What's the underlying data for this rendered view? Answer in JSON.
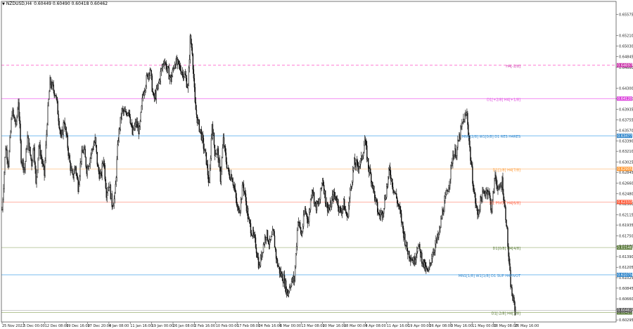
{
  "header": {
    "symbol": "NZDUSD,H4",
    "ohlc": "0.60449 0.60490 0.60418 0.60462"
  },
  "chart_data": {
    "type": "candlestick",
    "ylim": [
      0.6026,
      0.658
    ],
    "y_ticks": [
      "0.65575",
      "0.65210",
      "0.65030",
      "0.64845",
      "0.64660",
      "0.64300",
      "0.64120",
      "0.63935",
      "0.63755",
      "0.63570",
      "0.63390",
      "0.63210",
      "0.63025",
      "0.62845",
      "0.62660",
      "0.62480",
      "0.62300",
      "0.62115",
      "0.61935",
      "0.61750",
      "0.61570",
      "0.61390",
      "0.61205",
      "0.61025",
      "0.60845",
      "0.60660",
      "0.60480",
      "0.60295"
    ],
    "x_ticks": [
      "25 Nov 2022",
      "5 Dec 00:00",
      "12 Dec 08:00",
      "19 Dec 16:00",
      "27 Dec 20:00",
      "4 Jan 08:00",
      "11 Jan 16:00",
      "19 Jan 00:00",
      "26 Jan 08:00",
      "2 Feb 16:00",
      "10 Feb 00:00",
      "17 Feb 08:00",
      "24 Feb 16:00",
      "6 Mar 00:00",
      "13 Mar 08:00",
      "20 Mar 16:00",
      "28 Mar 00:00",
      "4 Apr 08:00",
      "11 Apr 16:00",
      "19 Apr 00:00",
      "26 Apr 08:00",
      "3 May 16:00",
      "11 May 00:00",
      "18 May 08:00",
      "25 May 16:00"
    ],
    "close_path": [
      [
        0,
        0.622
      ],
      [
        5,
        0.633
      ],
      [
        9,
        0.63
      ],
      [
        14,
        0.639
      ],
      [
        20,
        0.6365
      ],
      [
        23,
        0.641
      ],
      [
        27,
        0.631
      ],
      [
        32,
        0.629
      ],
      [
        36,
        0.6345
      ],
      [
        42,
        0.63
      ],
      [
        45,
        0.6335
      ],
      [
        48,
        0.6262
      ],
      [
        52,
        0.633
      ],
      [
        55,
        0.6315
      ],
      [
        60,
        0.628
      ],
      [
        64,
        0.6375
      ],
      [
        68,
        0.644
      ],
      [
        72,
        0.643
      ],
      [
        76,
        0.642
      ],
      [
        80,
        0.638
      ],
      [
        84,
        0.634
      ],
      [
        88,
        0.6375
      ],
      [
        92,
        0.634
      ],
      [
        96,
        0.63
      ],
      [
        100,
        0.6275
      ],
      [
        104,
        0.6295
      ],
      [
        108,
        0.626
      ],
      [
        112,
        0.631
      ],
      [
        116,
        0.6325
      ],
      [
        120,
        0.629
      ],
      [
        124,
        0.6305
      ],
      [
        128,
        0.6325
      ],
      [
        132,
        0.634
      ],
      [
        136,
        0.629
      ],
      [
        140,
        0.6275
      ],
      [
        144,
        0.631
      ],
      [
        148,
        0.625
      ],
      [
        152,
        0.6265
      ],
      [
        156,
        0.623
      ],
      [
        160,
        0.624
      ],
      [
        165,
        0.6345
      ],
      [
        170,
        0.639
      ],
      [
        175,
        0.6385
      ],
      [
        180,
        0.6395
      ],
      [
        185,
        0.635
      ],
      [
        190,
        0.637
      ],
      [
        195,
        0.6355
      ],
      [
        200,
        0.642
      ],
      [
        205,
        0.6445
      ],
      [
        210,
        0.6465
      ],
      [
        215,
        0.641
      ],
      [
        220,
        0.6425
      ],
      [
        225,
        0.6455
      ],
      [
        230,
        0.648
      ],
      [
        235,
        0.646
      ],
      [
        240,
        0.6445
      ],
      [
        245,
        0.6475
      ],
      [
        250,
        0.647
      ],
      [
        255,
        0.646
      ],
      [
        260,
        0.645
      ],
      [
        264,
        0.643
      ],
      [
        267,
        0.6515
      ],
      [
        270,
        0.6495
      ],
      [
        274,
        0.64
      ],
      [
        278,
        0.637
      ],
      [
        282,
        0.6355
      ],
      [
        286,
        0.633
      ],
      [
        290,
        0.6305
      ],
      [
        294,
        0.626
      ],
      [
        298,
        0.637
      ],
      [
        302,
        0.632
      ],
      [
        306,
        0.632
      ],
      [
        310,
        0.6275
      ],
      [
        314,
        0.634
      ],
      [
        318,
        0.6305
      ],
      [
        322,
        0.628
      ],
      [
        326,
        0.628
      ],
      [
        330,
        0.6255
      ],
      [
        334,
        0.622
      ],
      [
        338,
        0.6225
      ],
      [
        342,
        0.6265
      ],
      [
        346,
        0.6235
      ],
      [
        350,
        0.62
      ],
      [
        355,
        0.618
      ],
      [
        360,
        0.616
      ],
      [
        365,
        0.612
      ],
      [
        370,
        0.6155
      ],
      [
        375,
        0.618
      ],
      [
        380,
        0.616
      ],
      [
        385,
        0.618
      ],
      [
        390,
        0.613
      ],
      [
        395,
        0.611
      ],
      [
        400,
        0.61
      ],
      [
        405,
        0.6075
      ],
      [
        410,
        0.6095
      ],
      [
        415,
        0.61
      ],
      [
        420,
        0.6205
      ],
      [
        425,
        0.6175
      ],
      [
        430,
        0.622
      ],
      [
        435,
        0.62
      ],
      [
        440,
        0.626
      ],
      [
        445,
        0.6225
      ],
      [
        450,
        0.623
      ],
      [
        455,
        0.6275
      ],
      [
        460,
        0.623
      ],
      [
        465,
        0.622
      ],
      [
        470,
        0.6245
      ],
      [
        475,
        0.624
      ],
      [
        480,
        0.6215
      ],
      [
        485,
        0.623
      ],
      [
        490,
        0.6205
      ],
      [
        495,
        0.626
      ],
      [
        500,
        0.63
      ],
      [
        505,
        0.6295
      ],
      [
        510,
        0.6305
      ],
      [
        515,
        0.634
      ],
      [
        520,
        0.6295
      ],
      [
        525,
        0.627
      ],
      [
        530,
        0.6235
      ],
      [
        535,
        0.621
      ],
      [
        540,
        0.6215
      ],
      [
        545,
        0.625
      ],
      [
        550,
        0.629
      ],
      [
        555,
        0.626
      ],
      [
        560,
        0.624
      ],
      [
        565,
        0.6215
      ],
      [
        570,
        0.618
      ],
      [
        575,
        0.615
      ],
      [
        580,
        0.614
      ],
      [
        585,
        0.613
      ],
      [
        590,
        0.616
      ],
      [
        595,
        0.614
      ],
      [
        600,
        0.612
      ],
      [
        605,
        0.611
      ],
      [
        610,
        0.614
      ],
      [
        615,
        0.616
      ],
      [
        620,
        0.6175
      ],
      [
        625,
        0.6215
      ],
      [
        630,
        0.624
      ],
      [
        635,
        0.627
      ],
      [
        640,
        0.6315
      ],
      [
        645,
        0.632
      ],
      [
        650,
        0.635
      ],
      [
        655,
        0.6375
      ],
      [
        660,
        0.6385
      ],
      [
        665,
        0.631
      ],
      [
        670,
        0.625
      ],
      [
        675,
        0.621
      ],
      [
        680,
        0.624
      ],
      [
        685,
        0.625
      ],
      [
        690,
        0.6255
      ],
      [
        695,
        0.622
      ],
      [
        700,
        0.628
      ],
      [
        705,
        0.625
      ],
      [
        710,
        0.627
      ],
      [
        713,
        0.623
      ],
      [
        716,
        0.62
      ],
      [
        718,
        0.616
      ],
      [
        720,
        0.612
      ],
      [
        723,
        0.608
      ],
      [
        726,
        0.606
      ],
      [
        729,
        0.6046
      ]
    ],
    "levels": [
      {
        "label": "H4[-2/8]",
        "price": "0.64697",
        "color": "#ff66cc",
        "tag_color": "#cc33aa",
        "dashed": true
      },
      {
        "label": "D1[+2/8] H4[+1/8]",
        "price": "0.64120",
        "color": "#ee66ee",
        "tag_color": "#dd44dd",
        "dashed": false
      },
      {
        "label": "MN1[2/8] W1[0/8] D1 RES H4RES",
        "price": "0.63477",
        "color": "#66b3ee",
        "tag_color": "#3388cc",
        "dashed": false
      },
      {
        "label": "D1[1/8] H4[7/8]",
        "price": "0.62905",
        "color": "#ffcc99",
        "tag_color": "#ff9933",
        "dashed": false
      },
      {
        "label": "D1 PIVOT H4[6/8]",
        "price": "0.62333",
        "color": "#ff9988",
        "tag_color": "#ff5533",
        "dashed": false
      },
      {
        "label": "D1[0/8] H4[4/8]",
        "price": "0.61546",
        "color": "#aabb88",
        "tag_color": "#557733",
        "dashed": false
      },
      {
        "label": "MN1[1/8] W1[1/8] D1 SUP H4PIVOT",
        "price": "0.61075",
        "color": "#66b3ee",
        "tag_color": "#3388cc",
        "dashed": false
      },
      {
        "label": "D1[-2/8] H4[3/8]",
        "price": "0.60425",
        "color": "#aabb88",
        "tag_color": "#557733",
        "dashed": false
      }
    ],
    "current_price": {
      "price": "0.60462",
      "color": "#555555"
    }
  }
}
